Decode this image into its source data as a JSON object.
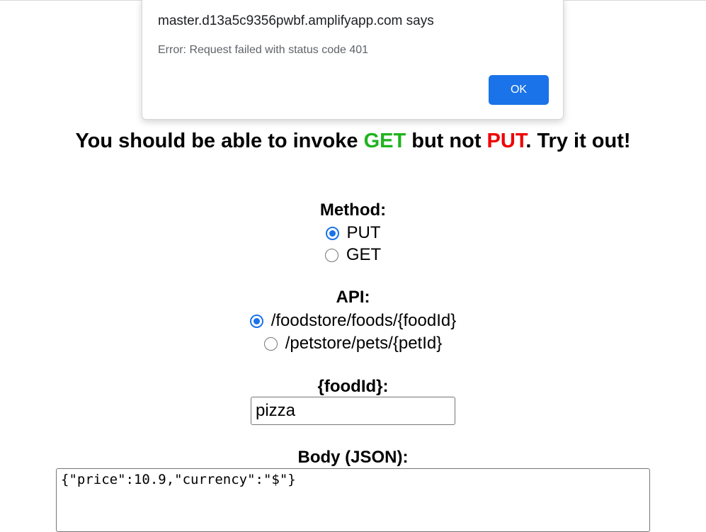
{
  "alert": {
    "title": "master.d13a5c9356pwbf.amplifyapp.com says",
    "message": "Error: Request failed with status code 401",
    "ok_label": "OK"
  },
  "headline": {
    "part1": "You should be able to invoke ",
    "get": "GET",
    "part2": " but not ",
    "put": "PUT",
    "part3": ". Try it out!"
  },
  "method": {
    "label": "Method:",
    "options": [
      {
        "label": "PUT",
        "selected": true
      },
      {
        "label": "GET",
        "selected": false
      }
    ]
  },
  "api": {
    "label": "API:",
    "options": [
      {
        "label": "/foodstore/foods/{foodId}",
        "selected": true
      },
      {
        "label": "/petstore/pets/{petId}",
        "selected": false
      }
    ]
  },
  "param": {
    "label": "{foodId}:",
    "value": "pizza"
  },
  "body": {
    "label": "Body (JSON):",
    "value": "{\"price\":10.9,\"currency\":\"$\"}"
  },
  "colors": {
    "get": "#1fb31f",
    "put": "#ee0000",
    "accent": "#1a73e8"
  }
}
